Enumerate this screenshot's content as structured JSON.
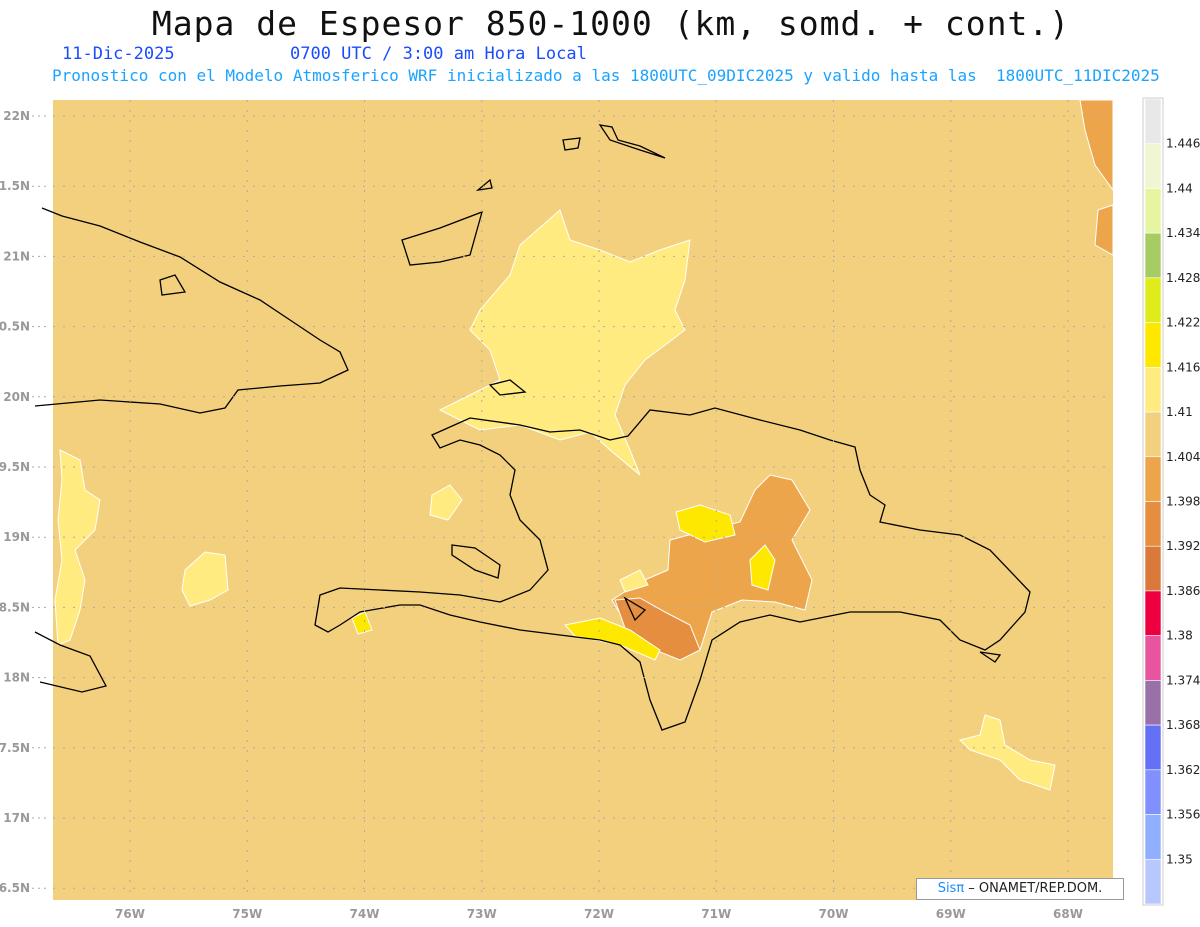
{
  "header": {
    "title": "Mapa de Espesor 850-1000 (km, somd. + cont.)",
    "date": "11-Dic-2025",
    "time": "0700 UTC / 3:00 am Hora Local",
    "subtitle": "Pronostico con el Modelo Atmosferico WRF inicializado a las 1800UTC_09DIC2025 y valido hasta las  1800UTC_11DIC2025"
  },
  "map": {
    "base_color": "#f3d07e",
    "lat_labels": [
      "22N",
      "1.5N",
      "21N",
      "0.5N",
      "20N",
      "9.5N",
      "19N",
      "8.5N",
      "18N",
      "7.5N",
      "17N",
      "6.5N"
    ],
    "lon_labels": [
      "76W",
      "75W",
      "74W",
      "73W",
      "72W",
      "71W",
      "70W",
      "69W",
      "68W"
    ],
    "coastline_color": "#000000",
    "grid": "dotted"
  },
  "colorbar": {
    "labels": [
      "1.446",
      "1.44",
      "1.434",
      "1.428",
      "1.422",
      "1.416",
      "1.41",
      "1.404",
      "1.398",
      "1.392",
      "1.386",
      "1.38",
      "1.374",
      "1.368",
      "1.362",
      "1.356",
      "1.35"
    ],
    "colors": [
      "#e8e8e8",
      "#f0f5d2",
      "#e6f5a0",
      "#a8cc64",
      "#e0eb1a",
      "#ffe800",
      "#ffeb80",
      "#f3d07e",
      "#eda54b",
      "#e68e40",
      "#d97a3a",
      "#ee0040",
      "#e8559e",
      "#9a70a8",
      "#6470f5",
      "#8090ff",
      "#90b0ff",
      "#b8c8ff"
    ]
  },
  "credit": {
    "brand": "Sisπ",
    "text": " – ONAMET/REP.DOM."
  }
}
